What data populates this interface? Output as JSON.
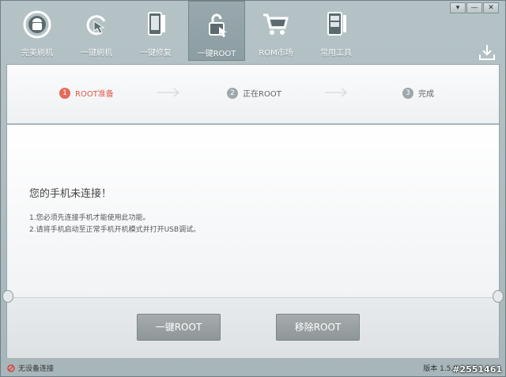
{
  "window_controls": [
    "▾",
    "—",
    "✕"
  ],
  "toolbar": {
    "items": [
      {
        "label": "完美刷机",
        "icon": "android-refresh-icon",
        "active": false
      },
      {
        "label": "一键刷机",
        "icon": "touch-refresh-icon",
        "active": false
      },
      {
        "label": "一键修复",
        "icon": "phone-tools-icon",
        "active": false
      },
      {
        "label": "一键ROOT",
        "icon": "unlock-touch-icon",
        "active": true
      },
      {
        "label": "ROM市场",
        "icon": "shopping-cart-icon",
        "active": false
      },
      {
        "label": "常用工具",
        "icon": "phone-toolbox-icon",
        "active": false
      }
    ]
  },
  "steps": [
    {
      "num": "1",
      "label": "ROOT准备",
      "active": true
    },
    {
      "num": "2",
      "label": "正在ROOT",
      "active": false
    },
    {
      "num": "3",
      "label": "完成",
      "active": false
    }
  ],
  "content": {
    "title": "您的手机未连接！",
    "hint1": "1.您必须先连接手机才能使用此功能。",
    "hint2": "2.请将手机启动至正常手机开机模式并打开USB调试。"
  },
  "buttons": {
    "root": "一键ROOT",
    "remove_root": "移除ROOT"
  },
  "status": {
    "connection": "无设备连接",
    "right": "版本 1.5.0"
  },
  "watermark": "#2551461",
  "colors": {
    "accent": "#e2574a",
    "button": "#9aa1a3"
  }
}
